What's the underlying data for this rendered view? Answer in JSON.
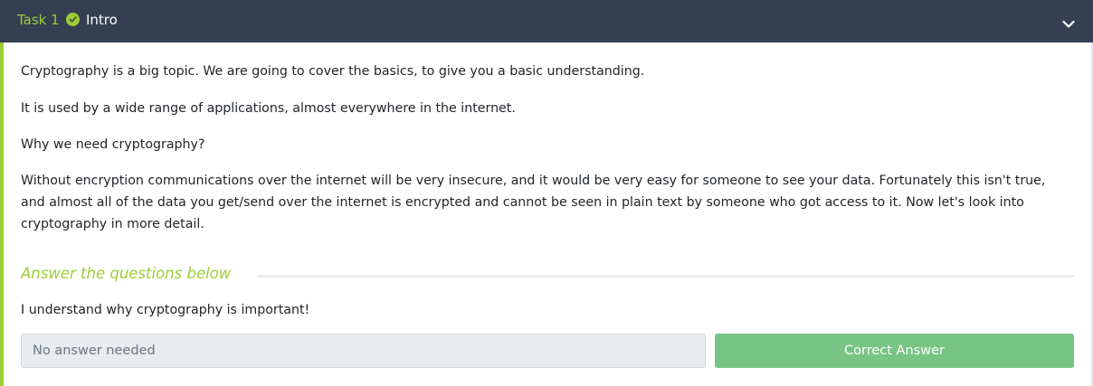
{
  "task": {
    "number_label": "Task 1",
    "title": "Intro",
    "status_icon": "check-circle-icon",
    "toggle_icon": "chevron-down-icon"
  },
  "content": {
    "paragraphs": [
      "Cryptography is a big topic. We are going to cover the basics, to give you a basic understanding.",
      "It is used by a wide range of applications, almost everywhere in the internet.",
      "Why we need cryptography?",
      "Without encryption communications over the internet will be very insecure, and it would be very easy for someone to see your data. Fortunately this isn't true, and almost all of the data you get/send over the internet is encrypted and cannot be seen in plain text by someone who got access to it. Now let's look into cryptography in more detail."
    ]
  },
  "questions": {
    "heading": "Answer the questions below",
    "items": [
      {
        "text": "I understand why cryptography is important!",
        "placeholder": "No answer needed",
        "button_label": "Correct Answer"
      }
    ]
  },
  "colors": {
    "header_bg": "#343f52",
    "accent_green": "#9ccd35",
    "button_green": "#78c485",
    "input_bg": "#e9ecef"
  }
}
